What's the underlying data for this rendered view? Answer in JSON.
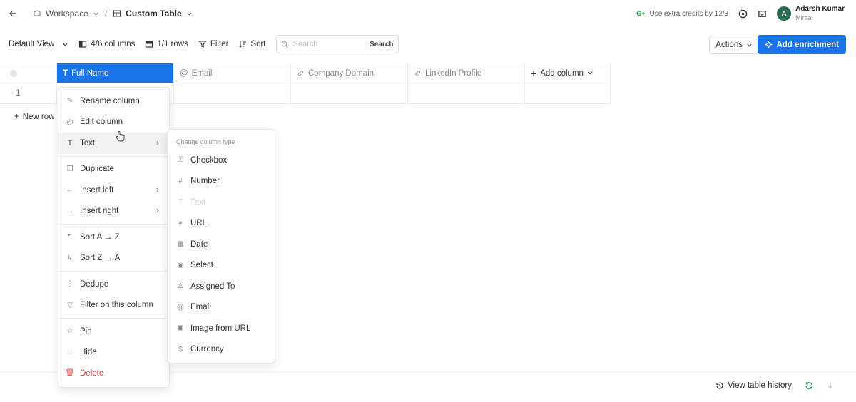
{
  "breadcrumb": {
    "workspace": "Workspace",
    "table": "Custom Table"
  },
  "header": {
    "credits_badge": "G+",
    "credits_text": "Use extra credits by 12/3",
    "user_initial": "A",
    "user_name": "Adarsh Kumar",
    "user_org": "Miraa"
  },
  "toolbar": {
    "view": "Default View",
    "columns": "4/6 columns",
    "rows": "1/1 rows",
    "filter": "Filter",
    "sort": "Sort",
    "search_placeholder": "Search",
    "search_button": "Search",
    "actions": "Actions",
    "enrich": "Add enrichment"
  },
  "table": {
    "columns": [
      {
        "label": "Full Name",
        "icon": "text-icon"
      },
      {
        "label": "Email",
        "icon": "at-icon"
      },
      {
        "label": "Company Domain",
        "icon": "link-icon"
      },
      {
        "label": "LinkedIn Profile",
        "icon": "link-icon"
      }
    ],
    "add_column": "Add column",
    "row_number": "1",
    "new_row": "New row"
  },
  "menu": {
    "rename": "Rename column",
    "edit": "Edit column",
    "type": "Text",
    "duplicate": "Duplicate",
    "insert_left": "Insert left",
    "insert_right": "Insert right",
    "sort_az": "Sort A → Z",
    "sort_za": "Sort Z → A",
    "dedupe": "Dedupe",
    "filter": "Filter on this column",
    "pin": "Pin",
    "hide": "Hide",
    "delete": "Delete"
  },
  "submenu": {
    "title": "Change column type",
    "items": [
      "Checkbox",
      "Number",
      "Text",
      "URL",
      "Date",
      "Select",
      "Assigned To",
      "Email",
      "Image from URL",
      "Currency"
    ]
  },
  "footer": {
    "history": "View table history"
  },
  "colors": {
    "accent": "#1a73e8",
    "danger": "#d63b3b",
    "avatar": "#2d6b50"
  }
}
